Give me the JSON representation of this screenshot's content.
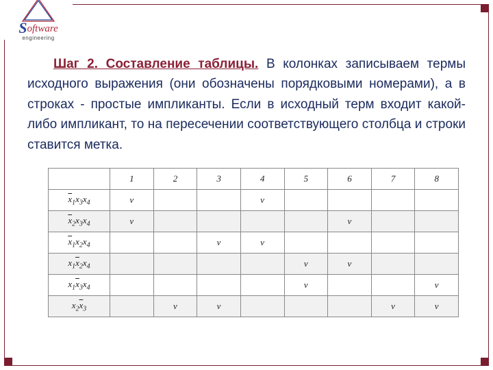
{
  "logo": {
    "word_s": "S",
    "word_rest": "oftware",
    "sub": "engineering"
  },
  "heading": "Шаг 2. Составление таблицы.",
  "paragraph": "В колонках записываем термы исходного выражения (они обозначены порядковыми номерами), а в строках - простые импликанты. Если в исходный терм входит какой-либо импликант, то на пересечении соответствующего столбца и строки ставится метка.",
  "chart_data": {
    "type": "table",
    "columns": [
      "1",
      "2",
      "3",
      "4",
      "5",
      "6",
      "7",
      "8"
    ],
    "rows": [
      {
        "label": "x̄1x3x4",
        "marks": [
          "v",
          "",
          "",
          "v",
          "",
          "",
          "",
          ""
        ]
      },
      {
        "label": "x̄2x3x4",
        "marks": [
          "v",
          "",
          "",
          "",
          "",
          "v",
          "",
          ""
        ]
      },
      {
        "label": "x̄1x2x4",
        "marks": [
          "",
          "",
          "v",
          "v",
          "",
          "",
          "",
          ""
        ]
      },
      {
        "label": "x1x̄2x4",
        "marks": [
          "",
          "",
          "",
          "",
          "v",
          "v",
          "",
          ""
        ]
      },
      {
        "label": "x1x̄3x4",
        "marks": [
          "",
          "",
          "",
          "",
          "v",
          "",
          "",
          "v"
        ]
      },
      {
        "label": "x2x̄3",
        "marks": [
          "",
          "v",
          "v",
          "",
          "",
          "",
          "v",
          "v"
        ]
      }
    ]
  }
}
